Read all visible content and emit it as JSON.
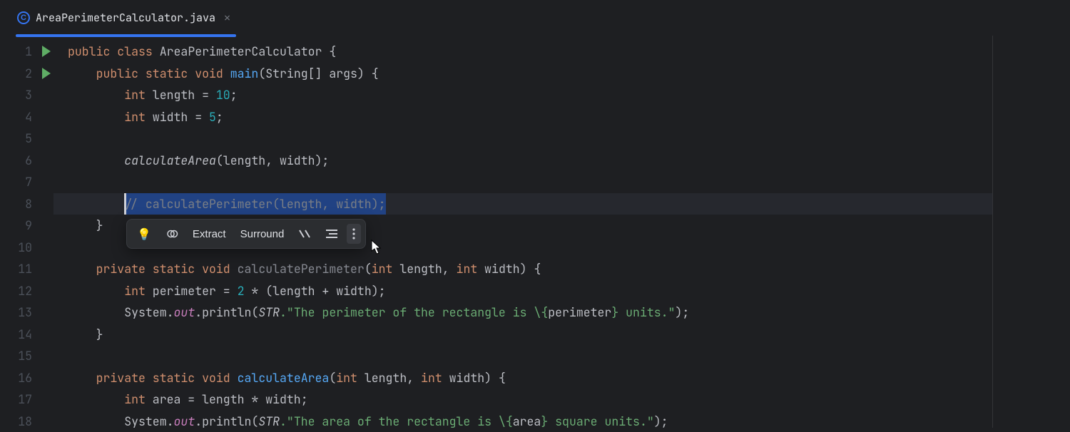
{
  "tab": {
    "label": "AreaPerimeterCalculator.java",
    "icon": "C"
  },
  "gutter": {
    "lines": [
      "1",
      "2",
      "3",
      "4",
      "5",
      "6",
      "7",
      "8",
      "9",
      "10",
      "11",
      "12",
      "13",
      "14",
      "15",
      "16",
      "17",
      "18"
    ],
    "run_at": [
      0,
      1
    ]
  },
  "code": {
    "l1": {
      "kw1": "public class",
      "cls": "AreaPerimeterCalculator",
      "br": " {"
    },
    "l2": {
      "kw1": "public static void",
      "fn": "main",
      "args": "(String[] args) {"
    },
    "l3": {
      "kw": "int",
      "var": " length = ",
      "num": "10",
      "end": ";"
    },
    "l4": {
      "kw": "int",
      "var": " width = ",
      "num": "5",
      "end": ";"
    },
    "l6": {
      "fn": "calculateArea",
      "args": "(length, width);"
    },
    "l8": {
      "cmt": "// calculatePerimeter(length, width);"
    },
    "l9": {
      "br": "}"
    },
    "l11": {
      "kw1": "private static void",
      "fn": "calculatePerimeter",
      "args": "(",
      "kw2": "int",
      "p1": " length, ",
      "kw3": "int",
      "p2": " width) {"
    },
    "l12": {
      "kw": "int",
      "var": " perimeter = ",
      "num": "2",
      "rest": " * (length + width);"
    },
    "l13": {
      "a": "System.",
      "out": "out",
      "b": ".println(",
      "str1": "STR",
      "str2": ".\"The perimeter of the rectangle is \\{",
      "v": "perimeter",
      "str3": "} units.\"",
      "end": ");"
    },
    "l14": {
      "br": "}"
    },
    "l16": {
      "kw1": "private static void",
      "fn": "calculateArea",
      "args": "(",
      "kw2": "int",
      "p1": " length, ",
      "kw3": "int",
      "p2": " width) {"
    },
    "l17": {
      "kw": "int",
      "var": " area = length * width;"
    },
    "l18": {
      "a": "System.",
      "out": "out",
      "b": ".println(",
      "str1": "STR",
      "str2": ".\"The area of the rectangle is \\{",
      "v": "area",
      "str3": "} square units.\"",
      "end": ");"
    }
  },
  "popup": {
    "extract": "Extract",
    "surround": "Surround"
  }
}
